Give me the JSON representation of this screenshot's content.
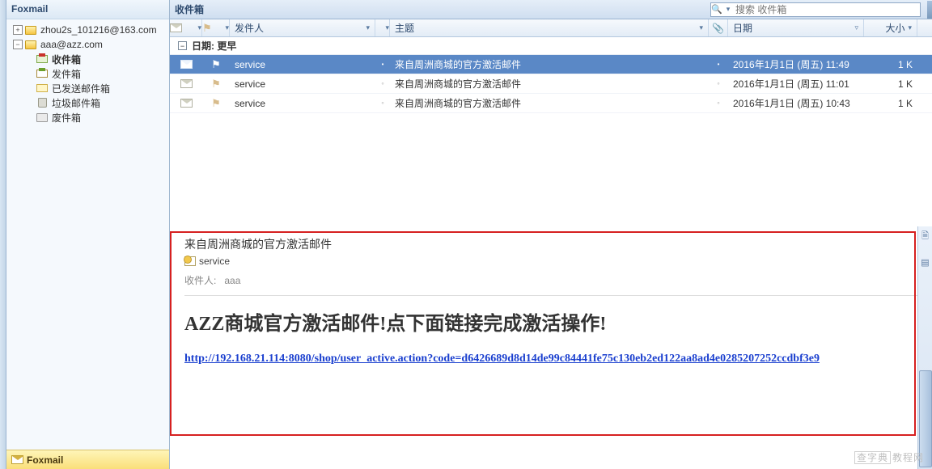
{
  "app_name": "Foxmail",
  "sidebar": {
    "accounts": [
      {
        "label": "zhou2s_101216@163.com",
        "expanded": "+"
      },
      {
        "label": "aaa@azz.com",
        "expanded": "−"
      }
    ],
    "folders": [
      {
        "label": "收件箱",
        "kind": "inbox"
      },
      {
        "label": "发件箱",
        "kind": "outbox"
      },
      {
        "label": "已发送邮件箱",
        "kind": "sent"
      },
      {
        "label": "垃圾邮件箱",
        "kind": "trash"
      },
      {
        "label": "废件箱",
        "kind": "deleted"
      }
    ],
    "footer": "Foxmail"
  },
  "toolbar": {
    "title": "收件箱",
    "search_placeholder": "搜索 收件箱"
  },
  "columns": {
    "sender": "发件人",
    "subject": "主题",
    "date": "日期",
    "size": "大小"
  },
  "group": {
    "label": "日期: 更早"
  },
  "mails": [
    {
      "sender": "service",
      "subject": "来自周洲商城的官方激活邮件",
      "date": "2016年1月1日 (周五) 11:49",
      "size": "1 K",
      "selected": true
    },
    {
      "sender": "service",
      "subject": "来自周洲商城的官方激活邮件",
      "date": "2016年1月1日 (周五) 11:01",
      "size": "1 K",
      "selected": false
    },
    {
      "sender": "service",
      "subject": "来自周洲商城的官方激活邮件",
      "date": "2016年1月1日 (周五) 10:43",
      "size": "1 K",
      "selected": false
    }
  ],
  "preview": {
    "subject": "来自周洲商城的官方激活邮件",
    "sender": "service",
    "recipient_label": "收件人:",
    "recipient": "aaa",
    "heading": "AZZ商城官方激活邮件!点下面链接完成激活操作!",
    "link": "http://192.168.21.114:8080/shop/user_active.action?code=d6426689d8d14de99c84441fe75c130eb2ed122aa8ad4e0285207252ccdbf3e9"
  },
  "watermark": {
    "a": "查字典",
    "b": "教程网"
  }
}
